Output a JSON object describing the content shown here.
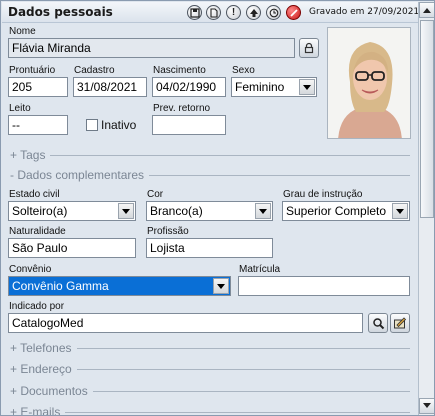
{
  "header": {
    "title": "Dados pessoais",
    "saved_text": "Gravado em 27/09/2021",
    "buttons": [
      {
        "name": "save-icon",
        "glyph": "▣"
      },
      {
        "name": "document-icon",
        "glyph": "▤"
      },
      {
        "name": "alert-icon",
        "glyph": "!"
      },
      {
        "name": "up-arrow-icon",
        "glyph": "▲"
      },
      {
        "name": "clock-icon",
        "glyph": "◔"
      },
      {
        "name": "no-entry-icon",
        "glyph": "⊘"
      }
    ]
  },
  "fields": {
    "nome": {
      "label": "Nome",
      "value": "Flávia Miranda"
    },
    "prontuario": {
      "label": "Prontuário",
      "value": "205"
    },
    "cadastro": {
      "label": "Cadastro",
      "value": "31/08/2021"
    },
    "nascimento": {
      "label": "Nascimento",
      "value": "04/02/1990"
    },
    "sexo": {
      "label": "Sexo",
      "value": "Feminino"
    },
    "leito": {
      "label": "Leito",
      "value": "--"
    },
    "inativo": {
      "label": "Inativo",
      "checked": false
    },
    "prev_retorno": {
      "label": "Prev. retorno",
      "value": ""
    },
    "estado_civil": {
      "label": "Estado civil",
      "value": "Solteiro(a)"
    },
    "cor": {
      "label": "Cor",
      "value": "Branco(a)"
    },
    "grau_instrucao": {
      "label": "Grau de instrução",
      "value": "Superior Completo"
    },
    "naturalidade": {
      "label": "Naturalidade",
      "value": "São Paulo"
    },
    "profissao": {
      "label": "Profissão",
      "value": "Lojista"
    },
    "convenio": {
      "label": "Convênio",
      "value": "Convênio Gamma"
    },
    "matricula": {
      "label": "Matrícula",
      "value": ""
    },
    "indicado_por": {
      "label": "Indicado por",
      "value": "CatalogoMed"
    }
  },
  "sections": {
    "tags": "+ Tags",
    "dados_complementares": "- Dados complementares",
    "telefones": "+ Telefones",
    "endereco": "+ Endereço",
    "documentos": "+ Documentos",
    "emails": "+ E-mails"
  },
  "colors": {
    "background": "#dfe6ee",
    "highlight": "#0a6fd6",
    "section_text": "#7b8694"
  }
}
